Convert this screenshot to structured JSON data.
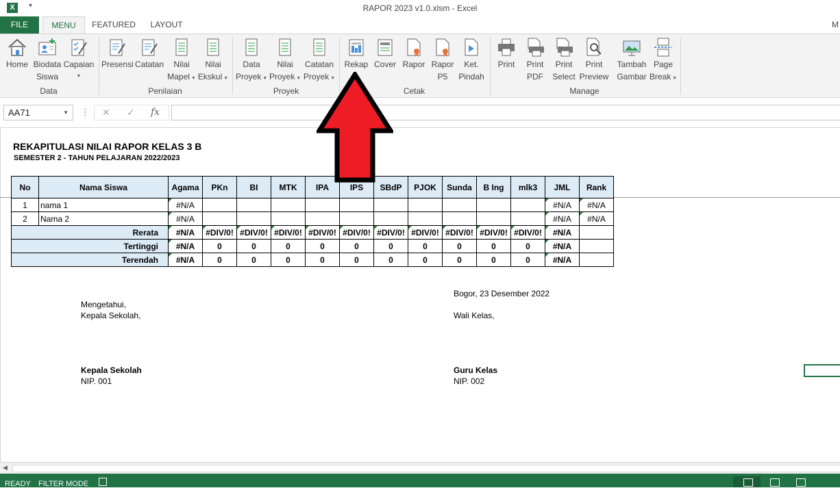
{
  "window": {
    "title": "RAPOR 2023 v1.0.xlsm - Excel",
    "app_icon": "X",
    "qa_caret": "▾"
  },
  "tabs": {
    "file": "FILE",
    "menu": "MENU",
    "featured": "FEATURED",
    "layout": "LAYOUT",
    "overflow": "M"
  },
  "ribbon": {
    "groups": {
      "data": "Data",
      "penilaian": "Penilaian",
      "proyek": "Proyek",
      "cetak": "Cetak",
      "manage": "Manage"
    },
    "buttons": {
      "home": [
        "Home",
        ""
      ],
      "biodata": [
        "Biodata",
        "Siswa"
      ],
      "capaian": [
        "Capaian",
        ""
      ],
      "presensi": [
        "Presensi",
        ""
      ],
      "catatan": [
        "Catatan",
        ""
      ],
      "nilai_mapel": [
        "Nilai",
        "Mapel"
      ],
      "nilai_ekskul": [
        "Nilai",
        "Ekskul"
      ],
      "data_proyek": [
        "Data",
        "Proyek"
      ],
      "nilai_proyek": [
        "Nilai",
        "Proyek"
      ],
      "catatan_proyek": [
        "Catatan",
        "Proyek"
      ],
      "rekap": [
        "Rekap",
        ""
      ],
      "cover": [
        "Cover",
        ""
      ],
      "rapor": [
        "Rapor",
        ""
      ],
      "rapor_p5": [
        "Rapor",
        "P5"
      ],
      "ket_pindah": [
        "Ket.",
        "Pindah"
      ],
      "print": [
        "Print",
        ""
      ],
      "print_pdf": [
        "Print",
        "PDF"
      ],
      "print_select": [
        "Print",
        "Select"
      ],
      "print_preview": [
        "Print",
        "Preview"
      ],
      "tambah_gambar": [
        "Tambah",
        "Gambar"
      ],
      "page_break": [
        "Page",
        "Break"
      ]
    }
  },
  "formula_bar": {
    "name_box": "AA71",
    "formula": "",
    "fx": "fx",
    "cancel": "✕",
    "enter": "✓"
  },
  "sheet": {
    "title": "REKAPITULASI NILAI RAPOR KELAS 3 B",
    "subtitle": "SEMESTER 2 - TAHUN PELAJARAN 2022/2023",
    "headers": [
      "No",
      "Nama Siswa",
      "Agama",
      "PKn",
      "BI",
      "MTK",
      "IPA",
      "IPS",
      "SBdP",
      "PJOK",
      "Sunda",
      "B Ing",
      "mlk3",
      "JML",
      "Rank"
    ],
    "students": [
      {
        "no": "1",
        "name": "nama 1",
        "agama": "#N/A",
        "jml": "#N/A",
        "rank": "#N/A"
      },
      {
        "no": "2",
        "name": "Nama 2",
        "agama": "#N/A",
        "jml": "#N/A",
        "rank": "#N/A"
      }
    ],
    "summary": [
      {
        "label": "Rerata",
        "agama": "#N/A",
        "subjects": [
          "#DIV/0!",
          "#DIV/0!",
          "#DIV/0!",
          "#DIV/0!",
          "#DIV/0!",
          "#DIV/0!",
          "#DIV/0!",
          "#DIV/0!",
          "#DIV/0!",
          "#DIV/0!"
        ],
        "jml": "#N/A"
      },
      {
        "label": "Tertinggi",
        "agama": "#N/A",
        "subjects": [
          "0",
          "0",
          "0",
          "0",
          "0",
          "0",
          "0",
          "0",
          "0",
          "0"
        ],
        "jml": "#N/A"
      },
      {
        "label": "Terendah",
        "agama": "#N/A",
        "subjects": [
          "0",
          "0",
          "0",
          "0",
          "0",
          "0",
          "0",
          "0",
          "0",
          "0"
        ],
        "jml": "#N/A"
      }
    ],
    "signature": {
      "mengetahui": "Mengetahui,",
      "kepala_label": "Kepala Sekolah,",
      "place_date": "Bogor, 23 Desember 2022",
      "wali_label": "Wali Kelas,",
      "kepala_name": "Kepala Sekolah",
      "kepala_nip": "NIP. 001",
      "guru_name": "Guru Kelas",
      "guru_nip": "NIP. 002"
    }
  },
  "status": {
    "ready": "READY",
    "filter_mode": "FILTER MODE"
  },
  "colors": {
    "excel_green": "#217346",
    "header_fill": "#ddebf7",
    "arrow_red": "#ee1c25"
  }
}
